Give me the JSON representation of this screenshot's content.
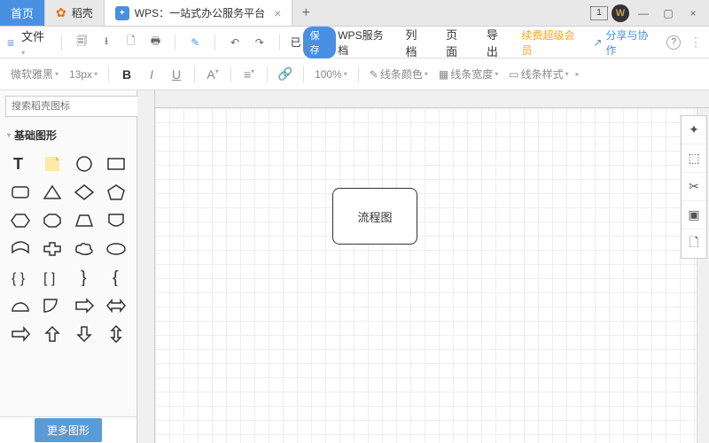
{
  "titlebar": {
    "tabs": [
      {
        "label": "首页",
        "icon": "home"
      },
      {
        "label": "稻壳",
        "icon": "fire"
      },
      {
        "label": "WPS：一站式办公服务平台",
        "icon": "app"
      }
    ],
    "num_indicator": "1"
  },
  "menubar": {
    "file_label": "文件",
    "sync_pill": "保存",
    "status_prefix": "已",
    "status_suffix": "WPS服务档",
    "tabs": [
      "列档",
      "页面",
      "导出"
    ],
    "premium": "续费超级会员",
    "share": "分享与协作"
  },
  "toolbar": {
    "font": "微软雅黑",
    "size": "13px",
    "zoom": "100%",
    "line_color": "线条颜色",
    "line_width": "线条宽度",
    "line_style": "线条样式"
  },
  "sidebar": {
    "search_placeholder": "搜索稻壳图标",
    "section": "基础图形",
    "more_button": "更多图形"
  },
  "canvas": {
    "node_text": "流程图"
  }
}
